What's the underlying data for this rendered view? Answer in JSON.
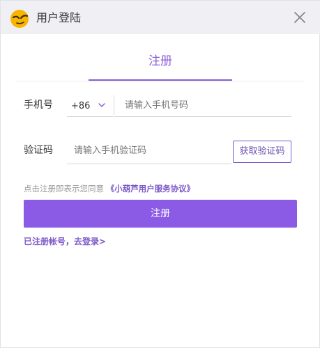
{
  "window": {
    "title": "用户登陆"
  },
  "titlebar": {
    "logo_icon": "gourd-face-logo-icon",
    "close_icon": "close-icon"
  },
  "tabs": [
    {
      "label": "注册",
      "active": true
    }
  ],
  "phone": {
    "label": "手机号",
    "country_code": "+86",
    "placeholder": "请输入手机号码",
    "value": ""
  },
  "verify": {
    "label": "验证码",
    "placeholder": "请输入手机验证码",
    "value": "",
    "get_code_label": "获取验证码"
  },
  "agreement": {
    "text": "点击注册即表示您同意",
    "link": "《小葫芦用户服务协议》"
  },
  "submit_label": "注册",
  "login_link": "已注册帐号，去登录>",
  "colors": {
    "accent": "#8b5be6",
    "accent_text": "#8a5cd8",
    "titlebar_bg": "#efeff4",
    "logo_yellow": "#f5b800"
  }
}
